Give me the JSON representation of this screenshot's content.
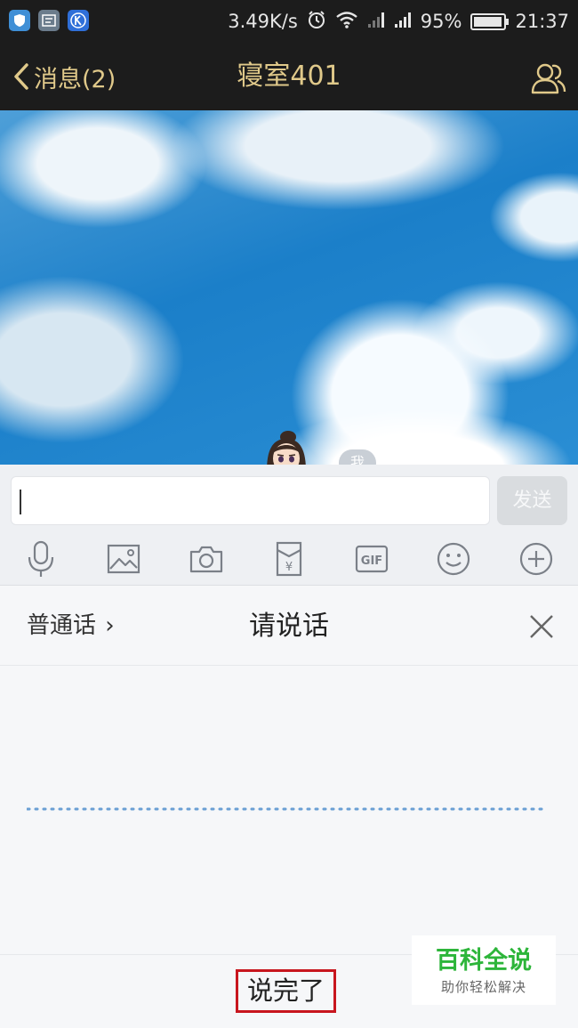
{
  "status_bar": {
    "network_speed": "3.49K/s",
    "battery_percent": "95%",
    "battery_level": 0.95,
    "time": "21:37",
    "icons": [
      "shield-icon",
      "app-icon",
      "k-app-icon",
      "alarm-icon",
      "wifi-icon",
      "signal-icon",
      "signal-icon",
      "battery-icon"
    ]
  },
  "nav": {
    "back_label": "消息(2)",
    "title": "寝室401",
    "profile_icon": "group-profile-icon"
  },
  "chat": {
    "me_label": "我"
  },
  "input": {
    "send_label": "发送"
  },
  "toolbar": {
    "tools": [
      "microphone-icon",
      "image-icon",
      "camera-icon",
      "red-packet-icon",
      "gif-icon",
      "emoji-icon",
      "plus-icon"
    ],
    "gif_label": "GIF",
    "red_packet_glyph": "¥"
  },
  "voice": {
    "language_label": "普通话",
    "language_chevron": "›",
    "prompt": "请说话",
    "done_label": "说完了"
  },
  "watermark": {
    "title": "百科全说",
    "subtitle": "助你轻松解决"
  },
  "colors": {
    "top_bar": "#1c1c1c",
    "gold_accent": "#e0c98a",
    "watermark_green": "#2db53a",
    "highlight_red": "#c8161e"
  }
}
